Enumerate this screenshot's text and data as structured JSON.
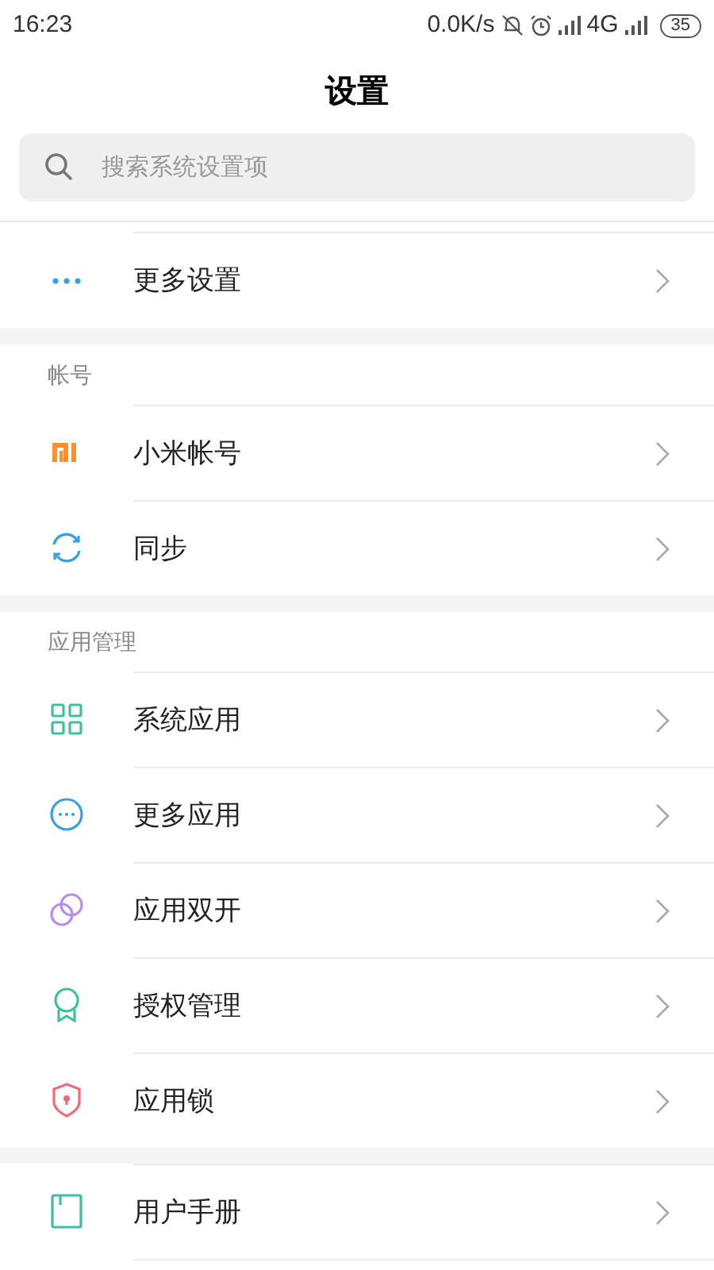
{
  "status_bar": {
    "time": "16:23",
    "speed": "0.0K/s",
    "network": "4G",
    "battery": "35"
  },
  "title": "设置",
  "search": {
    "placeholder": "搜索系统设置项"
  },
  "sections": [
    {
      "items": [
        {
          "label": "更多设置"
        }
      ]
    },
    {
      "header": "帐号",
      "items": [
        {
          "label": "小米帐号"
        },
        {
          "label": "同步"
        }
      ]
    },
    {
      "header": "应用管理",
      "items": [
        {
          "label": "系统应用"
        },
        {
          "label": "更多应用"
        },
        {
          "label": "应用双开"
        },
        {
          "label": "授权管理"
        },
        {
          "label": "应用锁"
        }
      ]
    },
    {
      "items": [
        {
          "label": "用户手册"
        }
      ]
    }
  ]
}
